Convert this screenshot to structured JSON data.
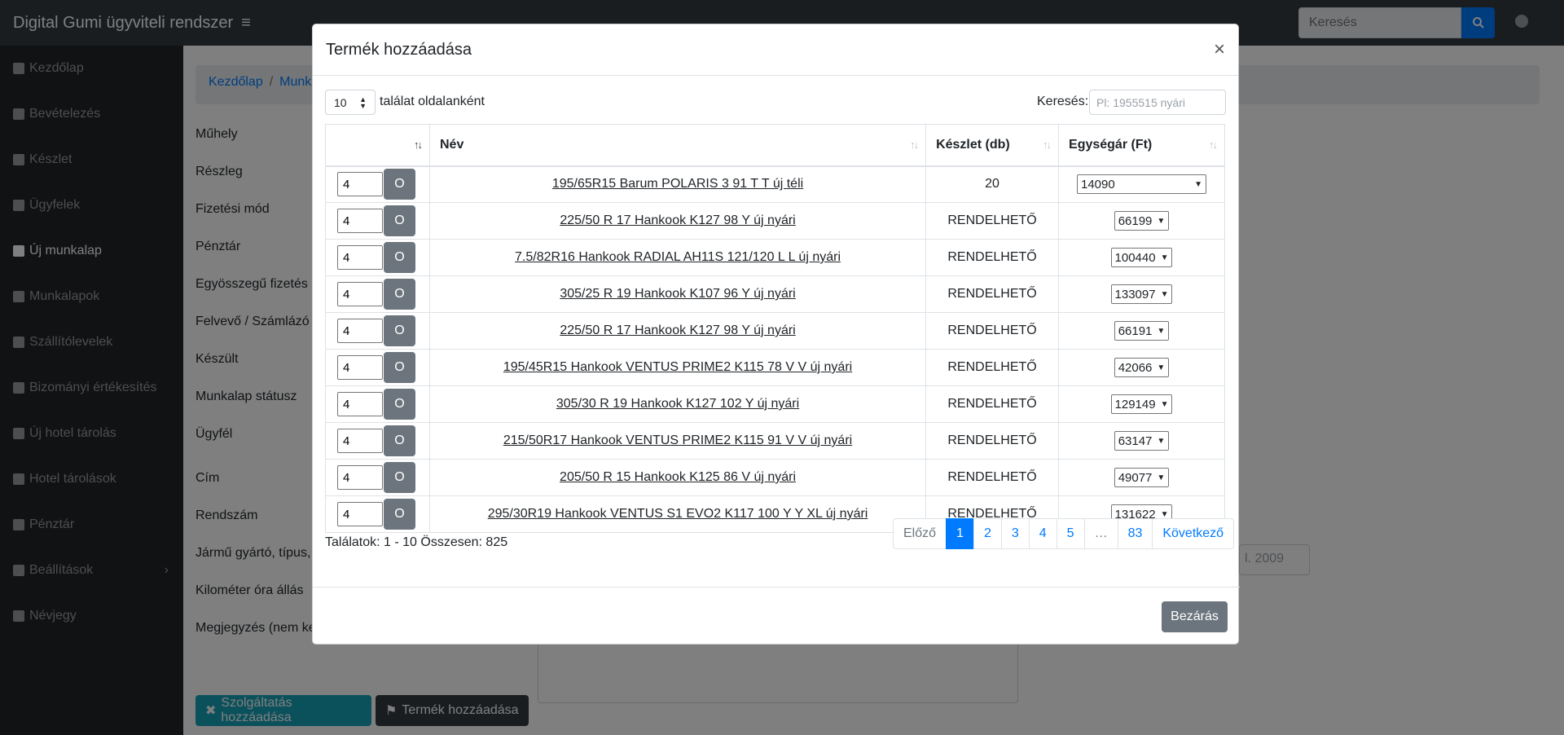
{
  "navbar": {
    "brand": "Digital Gumi ügyviteli rendszer",
    "toggler_icon": "hamburger-icon",
    "search_placeholder": "Keresés",
    "search_icon": "search-icon",
    "user_icon": "user-circle-icon"
  },
  "sidebar": {
    "items": [
      {
        "label": "Kezdőlap",
        "icon": "tachometer-icon"
      },
      {
        "label": "Bevételezés",
        "icon": "cubes-icon"
      },
      {
        "label": "Készlet",
        "icon": "warehouse-icon"
      },
      {
        "label": "Ügyfelek",
        "icon": "users-icon"
      },
      {
        "label": "Új munkalap",
        "icon": "file-icon"
      },
      {
        "label": "Munkalapok",
        "icon": "file-alt-icon"
      },
      {
        "label": "Szállítólevelek",
        "icon": "truck-icon"
      },
      {
        "label": "Bizományi értékesítés",
        "icon": "handshake-icon"
      },
      {
        "label": "Új hotel tárolás",
        "icon": "hotel-add-icon"
      },
      {
        "label": "Hotel tárolások",
        "icon": "building-icon"
      },
      {
        "label": "Pénztár",
        "icon": "cash-register-icon"
      },
      {
        "label": "Beállítások",
        "icon": "wrench-icon"
      },
      {
        "label": "Névjegy",
        "icon": "info-icon"
      }
    ],
    "active_index": 4
  },
  "main": {
    "breadcrumb": [
      "Kezdőlap",
      "Munk"
    ],
    "form_labels": [
      "Műhely",
      "Részleg",
      "Fizetési mód",
      "Pénztár",
      "Egyösszegű fizetés",
      "Felvevő / Számlázó",
      "Készült",
      "Munkalap státusz",
      "Ügyfél",
      "Cím",
      "Rendszám",
      "Jármű gyártó, típus,",
      "Kilométer óra állás",
      "Megjegyzés (nem ke"
    ],
    "year_placeholder": "l. 2009",
    "service_button": "Szolgáltatás hozzáadása",
    "product_button": "Termék hozzáadása",
    "colors": {
      "service_button": "#17a2b8",
      "product_button": "#343a40"
    }
  },
  "modal": {
    "title": "Termék hozzáadása",
    "close_symbol": "×",
    "page_length": "10",
    "page_length_suffix": "találat oldalanként",
    "search_label": "Keresés:",
    "search_placeholder": "Pl: 1955515 nyári",
    "columns": [
      "",
      "Név",
      "Készlet (db)",
      "Egységár (Ft)"
    ],
    "button_label": "O",
    "rows": [
      {
        "qty": "4",
        "name": "195/65R15 Barum POLARIS 3 91 T T új téli",
        "stock": "20",
        "price": "14090"
      },
      {
        "qty": "4",
        "name": "225/50 R 17 Hankook K127 98 Y új nyári",
        "stock": "RENDELHETŐ",
        "price": "66199"
      },
      {
        "qty": "4",
        "name": "7.5/82R16 Hankook RADIAL AH11S 121/120 L L új nyári",
        "stock": "RENDELHETŐ",
        "price": "100440"
      },
      {
        "qty": "4",
        "name": "305/25 R 19 Hankook K107 96 Y új nyári",
        "stock": "RENDELHETŐ",
        "price": "133097"
      },
      {
        "qty": "4",
        "name": "225/50 R 17 Hankook K127 98 Y új nyári",
        "stock": "RENDELHETŐ",
        "price": "66191"
      },
      {
        "qty": "4",
        "name": "195/45R15 Hankook VENTUS PRIME2 K115 78 V V új nyári",
        "stock": "RENDELHETŐ",
        "price": "42066"
      },
      {
        "qty": "4",
        "name": "305/30 R 19 Hankook K127 102 Y új nyári",
        "stock": "RENDELHETŐ",
        "price": "129149"
      },
      {
        "qty": "4",
        "name": "215/50R17 Hankook VENTUS PRIME2 K115 91 V V új nyári",
        "stock": "RENDELHETŐ",
        "price": "63147"
      },
      {
        "qty": "4",
        "name": "205/50 R 15 Hankook K125 86 V új nyári",
        "stock": "RENDELHETŐ",
        "price": "49077"
      },
      {
        "qty": "4",
        "name": "295/30R19 Hankook VENTUS S1 EVO2 K117 100 Y Y XL új nyári",
        "stock": "RENDELHETŐ",
        "price": "131622"
      }
    ],
    "info": "Találatok: 1 - 10 Összesen: 825",
    "pagination": {
      "prev": "Előző",
      "pages": [
        "1",
        "2",
        "3",
        "4",
        "5",
        "…",
        "83"
      ],
      "active": "1",
      "next": "Következő"
    },
    "footer_close": "Bezárás"
  }
}
